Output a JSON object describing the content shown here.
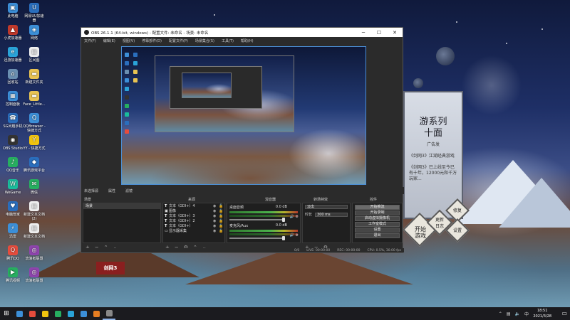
{
  "desktop": {
    "icons": [
      {
        "label": "此电脑",
        "color": "#3c8fd8",
        "glyph": "▣"
      },
      {
        "label": "网易UU加速器",
        "color": "#2a6ebd",
        "glyph": "U"
      },
      {
        "label": "小虎加速器",
        "color": "#c0392b",
        "glyph": "▲"
      },
      {
        "label": "网络",
        "color": "#3c8fd8",
        "glyph": "◈"
      },
      {
        "label": "迅游加速器",
        "color": "#2aa3d8",
        "glyph": "e"
      },
      {
        "label": "区间图",
        "color": "#f0f0f0",
        "glyph": "▤"
      },
      {
        "label": "回收站",
        "color": "#6b8fb0",
        "glyph": "⌂"
      },
      {
        "label": "新建文件夹",
        "color": "#e8c352",
        "glyph": "▬"
      },
      {
        "label": "控制面板",
        "color": "#3c8fd8",
        "glyph": "▦"
      },
      {
        "label": "Face_Little...",
        "color": "#e8c352",
        "glyph": "▬"
      },
      {
        "label": "SG问题手机",
        "color": "#2a6ebd",
        "glyph": "☎"
      },
      {
        "label": "QQBrowser - 快捷方式",
        "color": "#3c8fd8",
        "glyph": "Q"
      },
      {
        "label": "OBS Studio",
        "color": "#333333",
        "glyph": "◉"
      },
      {
        "label": "YY - 快捷方式",
        "color": "#f1c40f",
        "glyph": "Y"
      },
      {
        "label": "QQ音乐",
        "color": "#27ae60",
        "glyph": "♪"
      },
      {
        "label": "腾讯游戏平台",
        "color": "#2a6ebd",
        "glyph": "◆"
      },
      {
        "label": "WeGame",
        "color": "#1abc9c",
        "glyph": "W"
      },
      {
        "label": "微信",
        "color": "#27ae60",
        "glyph": "✉"
      },
      {
        "label": "电脑管家",
        "color": "#2a6ebd",
        "glyph": "♥"
      },
      {
        "label": "新建文本文档 (2)",
        "color": "#f0f0f0",
        "glyph": "▤"
      },
      {
        "label": "迅雷",
        "color": "#3c8fd8",
        "glyph": "⚡"
      },
      {
        "label": "新建文本文档",
        "color": "#f0f0f0",
        "glyph": "▤"
      },
      {
        "label": "腾讯QQ",
        "color": "#e74c3c",
        "glyph": "Q"
      },
      {
        "label": "流浪者联盟",
        "color": "#8e44ad",
        "glyph": "◎"
      },
      {
        "label": "腾讯视频",
        "color": "#27ae60",
        "glyph": "▶"
      },
      {
        "label": "流浪者联盟",
        "color": "#8e44ad",
        "glyph": "◎"
      }
    ]
  },
  "promo": {
    "title_line1": "游系列",
    "title_line2": "十面",
    "badge": "广告发",
    "subtitle": "《剑网3》江湖经典游戏",
    "body": "《剑网3》已上线至今已有十年，12000元和千万玩家...",
    "buttons": [
      {
        "label": "开始\n游戏"
      },
      {
        "label": "更新\n日志"
      },
      {
        "label": "修复"
      },
      {
        "label": "设置"
      }
    ],
    "logo_text": "剑网3"
  },
  "obs": {
    "title": "OBS 26.1.1 (64-bit, windows) - 配置文件: 未命名 - 场景: 未命名",
    "menu": [
      "文件(F)",
      "编辑(E)",
      "视图(V)",
      "停靠部件(D)",
      "配置文件(P)",
      "场景集合(S)",
      "工具(T)",
      "帮助(H)"
    ],
    "dock_header": [
      "未选择源",
      "属性",
      "滤镜"
    ],
    "panels": {
      "scenes_title": "场景",
      "sources_title": "来源",
      "mixer_title": "混音器",
      "transitions_title": "转场特效",
      "controls_title": "控件"
    },
    "scenes": [
      "场景"
    ],
    "sources": [
      {
        "type": "T",
        "name": "文本（GDI+）4"
      },
      {
        "type": "▣",
        "name": "图像"
      },
      {
        "type": "T",
        "name": "文本（GDI+）3"
      },
      {
        "type": "T",
        "name": "文本（GDI+）2"
      },
      {
        "type": "T",
        "name": "文本（GDI+）"
      },
      {
        "type": "▭",
        "name": "显示器采集"
      }
    ],
    "mixer": [
      {
        "name": "桌面音频",
        "level": "0.0 dB"
      },
      {
        "name": "麦克风/Aux",
        "level": "0.0 dB"
      }
    ],
    "transitions": {
      "type": "淡出",
      "duration_label": "时长",
      "duration_value": "300 ms"
    },
    "controls": [
      "开始推流",
      "开始录制",
      "启动虚拟摄像机",
      "工作室模式",
      "设置",
      "退出"
    ],
    "status": {
      "live": "LIVE: 00:00:00",
      "rec": "REC: 00:00:00",
      "cpu": "CPU: 0.5%, 30.00 fps",
      "dropped": "0/0"
    }
  },
  "taskbar": {
    "items": [
      {
        "color": "#3c8fd8",
        "name": "search"
      },
      {
        "color": "#e74c3c",
        "name": "qq"
      },
      {
        "color": "#f1c40f",
        "name": "explorer"
      },
      {
        "color": "#27ae60",
        "name": "video"
      },
      {
        "color": "#2aa3d8",
        "name": "browser"
      },
      {
        "color": "#3c8fd8",
        "name": "steam"
      },
      {
        "color": "#e67e22",
        "name": "chrome"
      },
      {
        "color": "#888888",
        "name": "obs"
      }
    ],
    "time": "18:51",
    "date": "2021/3/28",
    "ime": "中"
  }
}
